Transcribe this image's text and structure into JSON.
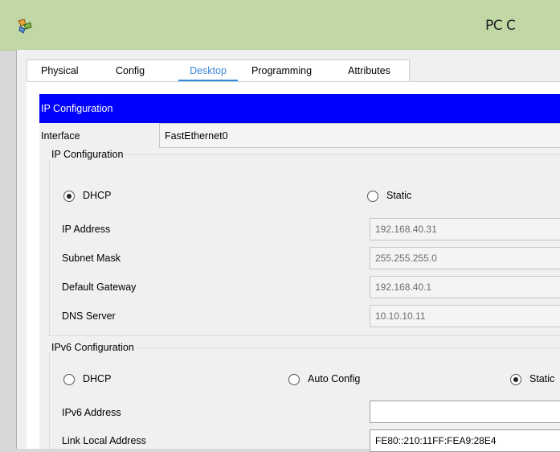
{
  "window": {
    "title": "PC C"
  },
  "tabs": [
    {
      "label": "Physical",
      "active": false
    },
    {
      "label": "Config",
      "active": false
    },
    {
      "label": "Desktop",
      "active": true
    },
    {
      "label": "Programming",
      "active": false
    },
    {
      "label": "Attributes",
      "active": false
    }
  ],
  "header": {
    "title": "IP Configuration"
  },
  "interface": {
    "label": "Interface",
    "value": "FastEthernet0"
  },
  "ipv4": {
    "group_title": "IP Configuration",
    "dhcp_label": "DHCP",
    "static_label": "Static",
    "selected": "DHCP",
    "ip_address": {
      "label": "IP Address",
      "value": "192.168.40.31"
    },
    "subnet_mask": {
      "label": "Subnet Mask",
      "value": "255.255.255.0"
    },
    "default_gateway": {
      "label": "Default Gateway",
      "value": "192.168.40.1"
    },
    "dns_server": {
      "label": "DNS Server",
      "value": "10.10.10.11"
    }
  },
  "ipv6": {
    "group_title": "IPv6 Configuration",
    "dhcp_label": "DHCP",
    "auto_label": "Auto Config",
    "static_label": "Static",
    "selected": "Static",
    "ipv6_address": {
      "label": "IPv6 Address",
      "value": ""
    },
    "link_local": {
      "label": "Link Local Address",
      "value": "FE80::210:11FF:FEA9:28E4"
    }
  },
  "colors": {
    "titlebar": "#c1d7a6",
    "header_bar": "#0000ff",
    "active_tab": "#3a86d6"
  }
}
